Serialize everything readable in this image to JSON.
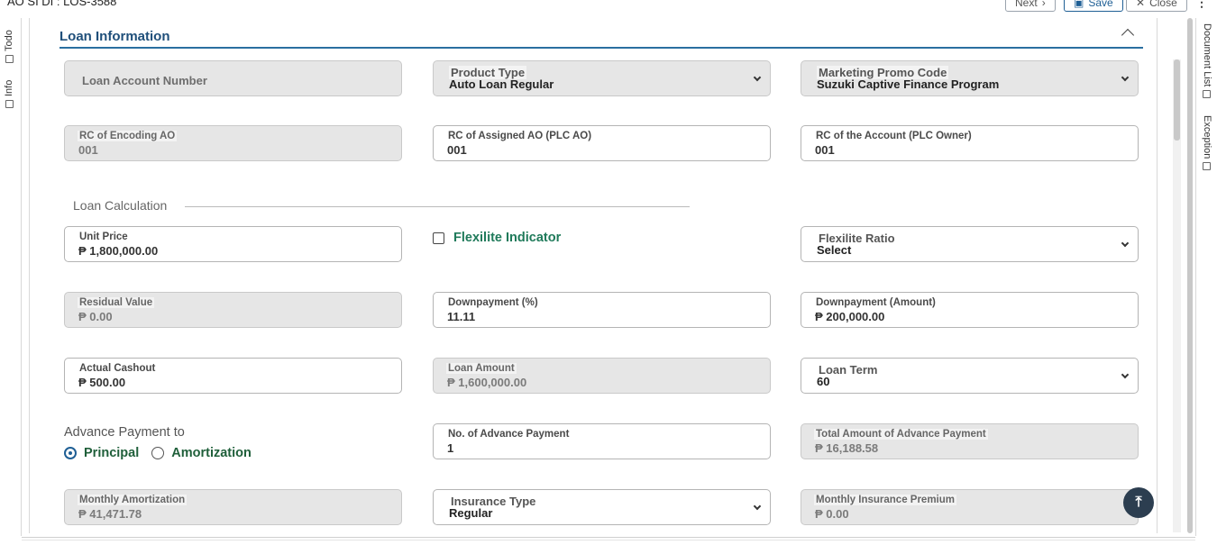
{
  "app": {
    "title": "AO SI DI : LOS-3588"
  },
  "toolbar": {
    "next_label": "Next",
    "save_label": "Save",
    "close_label": "Close"
  },
  "left_rail": {
    "todo_label": "Todo",
    "info_label": "Info"
  },
  "right_rail": {
    "document_list_label": "Document List",
    "exception_label": "Exception"
  },
  "section": {
    "title": "Loan Information"
  },
  "fields": {
    "loan_account_number": {
      "placeholder": "Loan Account Number"
    },
    "product_type": {
      "label": "Product Type",
      "value": "Auto Loan Regular"
    },
    "marketing_promo_code": {
      "label": "Marketing Promo Code",
      "value": "Suzuki Captive Finance Program"
    },
    "rc_encoding_ao": {
      "label": "RC of Encoding AO",
      "value": "001"
    },
    "rc_assigned_ao": {
      "label": "RC of Assigned AO (PLC AO)",
      "value": "001"
    },
    "rc_account": {
      "label": "RC of the Account (PLC Owner)",
      "value": "001"
    },
    "unit_price": {
      "label": "Unit Price",
      "value": "₱ 1,800,000.00"
    },
    "flexilite_indicator": {
      "label": "Flexilite Indicator"
    },
    "flexilite_ratio": {
      "label": "Flexilite Ratio",
      "value": "Select"
    },
    "residual_value": {
      "label": "Residual Value",
      "value": "₱ 0.00"
    },
    "downpayment_pct": {
      "label": "Downpayment (%)",
      "value": "11.11"
    },
    "downpayment_amt": {
      "label": "Downpayment (Amount)",
      "value": "₱ 200,000.00"
    },
    "actual_cashout": {
      "label": "Actual Cashout",
      "value": "₱ 500.00"
    },
    "loan_amount": {
      "label": "Loan Amount",
      "value": "₱ 1,600,000.00"
    },
    "loan_term": {
      "label": "Loan Term",
      "value": "60"
    },
    "no_advance_payment": {
      "label": "No. of Advance Payment",
      "value": "1"
    },
    "total_advance_payment": {
      "label": "Total Amount of Advance Payment",
      "value": "₱ 16,188.58"
    },
    "monthly_amortization": {
      "label": "Monthly Amortization",
      "value": "₱ 41,471.78"
    },
    "insurance_type": {
      "label": "Insurance Type",
      "value": "Regular"
    },
    "monthly_insurance_premium": {
      "label": "Monthly Insurance Premium",
      "value": "₱ 0.00"
    }
  },
  "loan_calculation": {
    "title": "Loan Calculation"
  },
  "advance_payment": {
    "label": "Advance Payment to",
    "options": [
      "Principal",
      "Amortization"
    ],
    "selected": "Principal"
  }
}
